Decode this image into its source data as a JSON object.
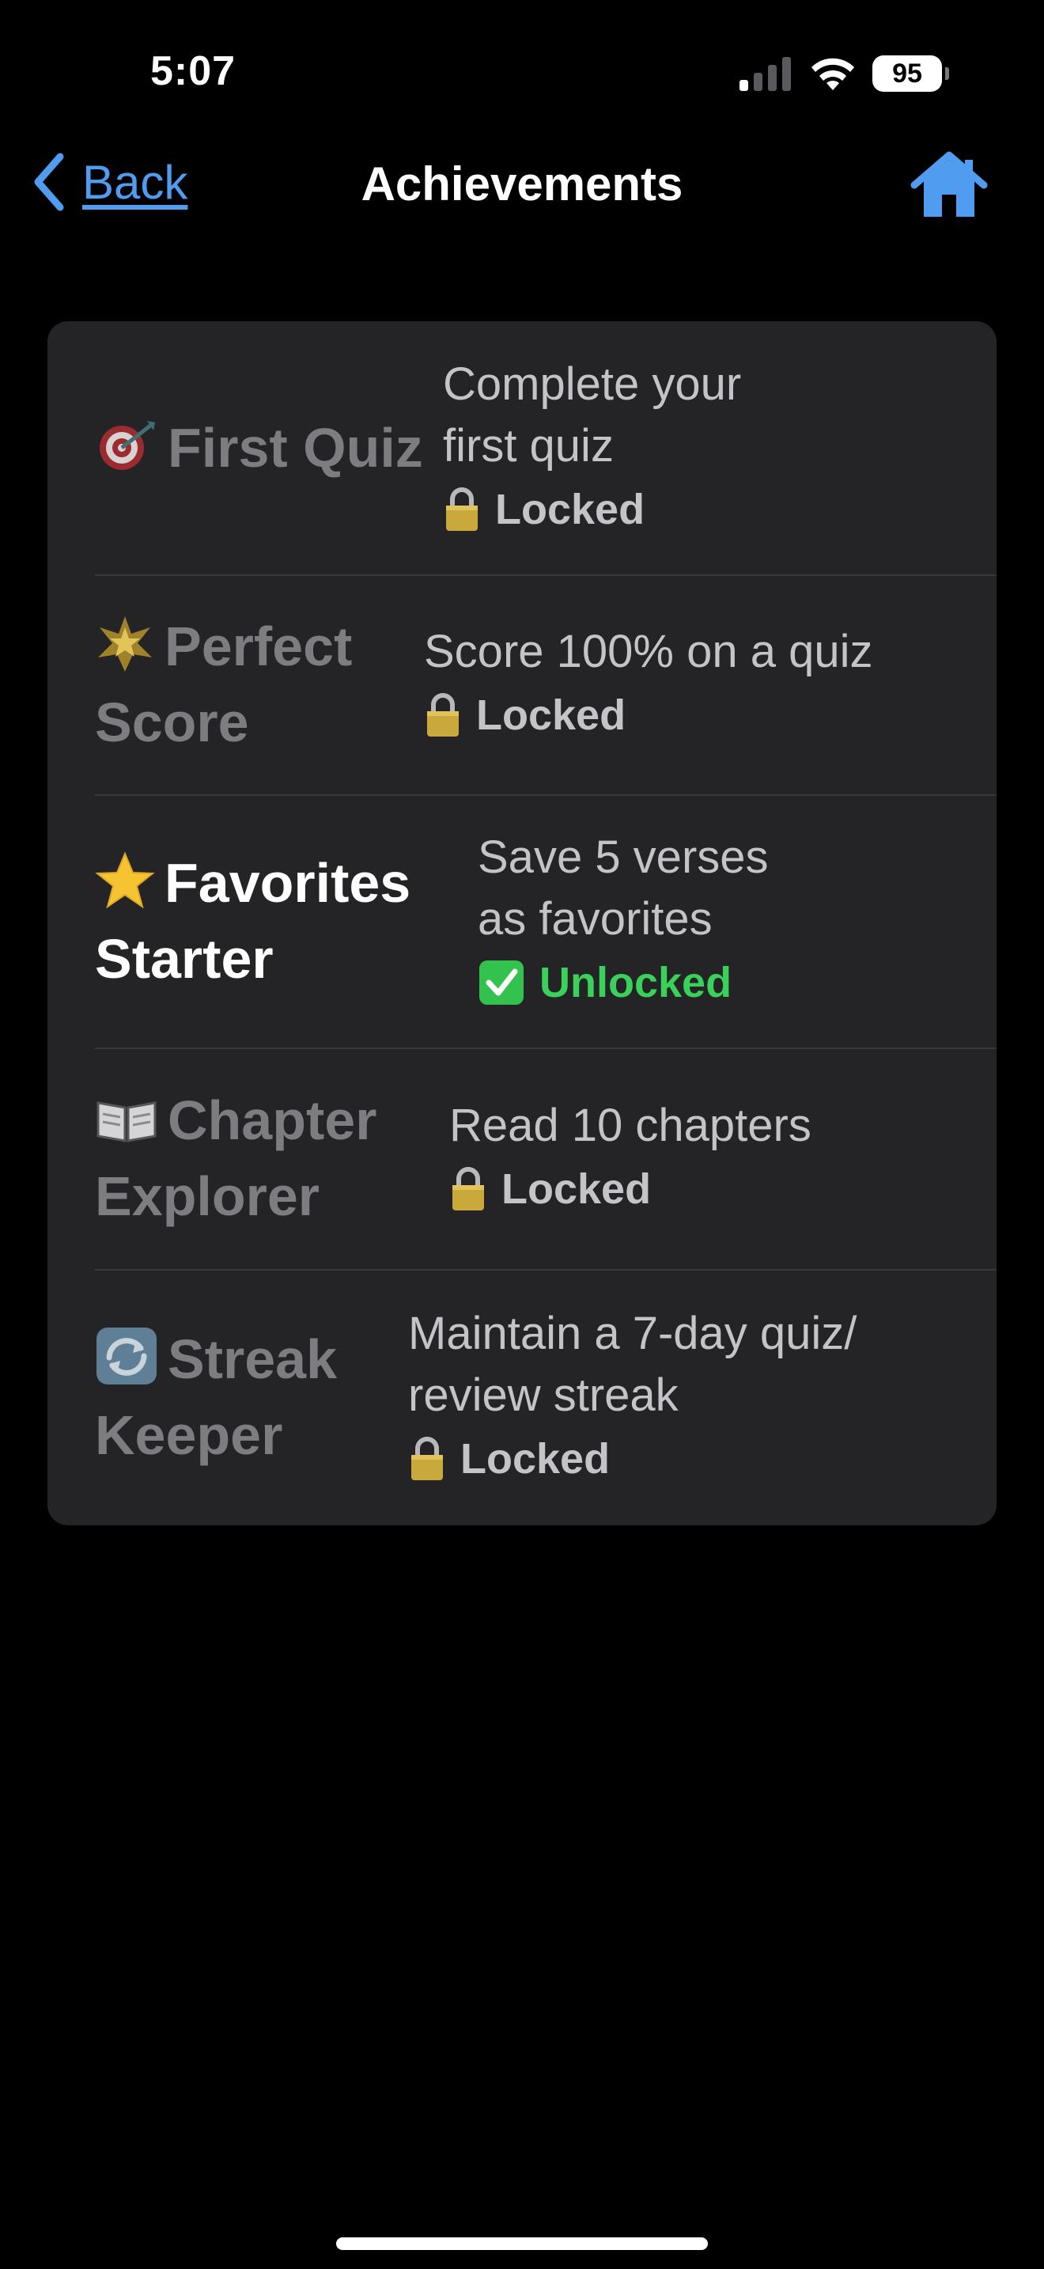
{
  "status_bar": {
    "time": "5:07",
    "battery_level": "95"
  },
  "nav": {
    "back_label": "Back",
    "title": "Achievements",
    "accent_color": "#4f9cf0"
  },
  "achievements": [
    {
      "icon": "target-icon",
      "title_main": "First Quiz",
      "title_cont": "",
      "description_line1": "Complete your",
      "description_line2": "first quiz",
      "status": "Locked",
      "unlocked": false
    },
    {
      "icon": "burst-star-icon",
      "title_main": "Perfect",
      "title_cont": "Score",
      "description_line1": "Score 100% on a quiz",
      "description_line2": "",
      "status": "Locked",
      "unlocked": false
    },
    {
      "icon": "star-icon",
      "title_main": "Favorites",
      "title_cont": "Starter",
      "description_line1": "Save 5 verses",
      "description_line2": "as favorites",
      "status": "Unlocked",
      "unlocked": true
    },
    {
      "icon": "open-book-icon",
      "title_main": "Chapter",
      "title_cont": "Explorer",
      "description_line1": "Read 10 chapters",
      "description_line2": "",
      "status": "Locked",
      "unlocked": false
    },
    {
      "icon": "repeat-icon",
      "title_main": "Streak",
      "title_cont": "Keeper",
      "description_line1": "Maintain a 7-day quiz/",
      "description_line2": "review streak",
      "status": "Locked",
      "unlocked": false
    }
  ],
  "colors": {
    "background": "#000000",
    "card": "#242426",
    "locked_text": "#7d7d81",
    "unlocked_status": "#3ad15a"
  }
}
